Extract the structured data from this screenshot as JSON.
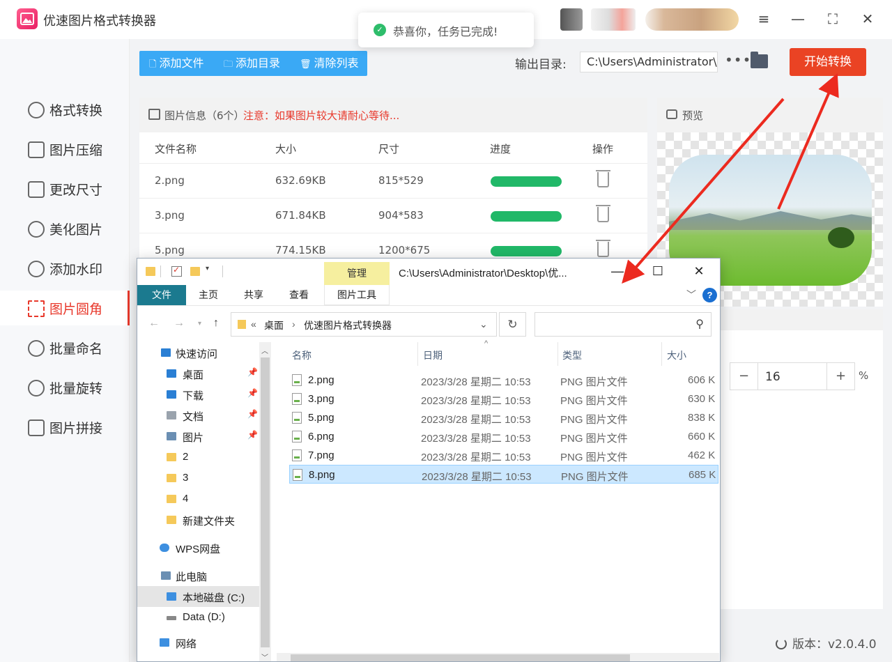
{
  "app": {
    "title": "优速图片格式转换器",
    "toast": "恭喜你，任务已完成!",
    "window_controls": [
      "≡",
      "—",
      "⛶",
      "✕"
    ]
  },
  "sidebar": {
    "items": [
      {
        "label": "格式转换",
        "icon": "convert-icon",
        "active": false
      },
      {
        "label": "图片压缩",
        "icon": "compress-icon",
        "active": false
      },
      {
        "label": "更改尺寸",
        "icon": "resize-icon",
        "active": false
      },
      {
        "label": "美化图片",
        "icon": "beautify-icon",
        "active": false
      },
      {
        "label": "添加水印",
        "icon": "watermark-icon",
        "active": false
      },
      {
        "label": "图片圆角",
        "icon": "rounded-corner-icon",
        "active": true
      },
      {
        "label": "批量命名",
        "icon": "rename-icon",
        "active": false
      },
      {
        "label": "批量旋转",
        "icon": "rotate-icon",
        "active": false
      },
      {
        "label": "图片拼接",
        "icon": "stitch-icon",
        "active": false
      }
    ]
  },
  "toolbar": {
    "add_file": "添加文件",
    "add_folder": "添加目录",
    "clear_list": "清除列表",
    "output_label": "输出目录:",
    "output_path": "C:\\Users\\Administrator\\",
    "more": "•••",
    "start": "开始转换"
  },
  "list": {
    "header_title": "图片信息（6个）",
    "header_notice": "注意：如果图片较大请耐心等待...",
    "columns": [
      "文件名称",
      "大小",
      "尺寸",
      "进度",
      "操作"
    ],
    "rows": [
      {
        "name": "2.png",
        "size": "632.69KB",
        "dims": "815*529",
        "progress": 1.0
      },
      {
        "name": "3.png",
        "size": "671.84KB",
        "dims": "904*583",
        "progress": 1.0
      },
      {
        "name": "5.png",
        "size": "774.15KB",
        "dims": "1200*675",
        "progress": 1.0
      }
    ]
  },
  "preview": {
    "label": "预览",
    "radius_value": "16",
    "radius_minus": "−",
    "radius_plus": "+",
    "radius_unit": "%"
  },
  "version": "版本：v2.0.4.0",
  "explorer": {
    "title_path": "C:\\Users\\Administrator\\Desktop\\优...",
    "manage_tab": "管理",
    "ribbon_tabs": [
      "文件",
      "主页",
      "共享",
      "查看",
      "图片工具"
    ],
    "breadcrumb": [
      "«",
      "桌面",
      "›",
      "优速图片格式转换器"
    ],
    "nav": [
      {
        "label": "快速访问",
        "color": "#2a7fd4",
        "pinned": false
      },
      {
        "label": "桌面",
        "color": "#2a7fd4",
        "pinned": true
      },
      {
        "label": "下载",
        "color": "#2a7fd4",
        "pinned": true
      },
      {
        "label": "文档",
        "color": "#9aa3ad",
        "pinned": true
      },
      {
        "label": "图片",
        "color": "#6b8fb3",
        "pinned": true
      },
      {
        "label": "2",
        "color": "#f5c95a",
        "pinned": false
      },
      {
        "label": "3",
        "color": "#f5c95a",
        "pinned": false
      },
      {
        "label": "4",
        "color": "#f5c95a",
        "pinned": false
      },
      {
        "label": "新建文件夹",
        "color": "#f5c95a",
        "pinned": false
      },
      {
        "label": "WPS网盘",
        "color": "#3d8fe0",
        "pinned": false
      },
      {
        "label": "此电脑",
        "color": "#6b8fb3",
        "pinned": false
      },
      {
        "label": "本地磁盘 (C:)",
        "color": "#3d8fe0",
        "pinned": false
      },
      {
        "label": "Data (D:)",
        "color": "#888888",
        "pinned": false
      },
      {
        "label": "网络",
        "color": "#3d8fe0",
        "pinned": false
      }
    ],
    "columns": [
      "名称",
      "日期",
      "类型",
      "大小"
    ],
    "files": [
      {
        "name": "2.png",
        "date": "2023/3/28 星期二 10:53",
        "type": "PNG 图片文件",
        "size": "606 K"
      },
      {
        "name": "3.png",
        "date": "2023/3/28 星期二 10:53",
        "type": "PNG 图片文件",
        "size": "630 K"
      },
      {
        "name": "5.png",
        "date": "2023/3/28 星期二 10:53",
        "type": "PNG 图片文件",
        "size": "838 K"
      },
      {
        "name": "6.png",
        "date": "2023/3/28 星期二 10:53",
        "type": "PNG 图片文件",
        "size": "660 K"
      },
      {
        "name": "7.png",
        "date": "2023/3/28 星期二 10:53",
        "type": "PNG 图片文件",
        "size": "462 K"
      },
      {
        "name": "8.png",
        "date": "2023/3/28 星期二 10:53",
        "type": "PNG 图片文件",
        "size": "685 K"
      }
    ],
    "selected_file": "8.png"
  },
  "colors": {
    "accent_red": "#e8382b",
    "start_button": "#ea4324",
    "toolbar_blue": "#3aa9f5",
    "progress_green": "#21b868",
    "annotation_arrow": "#ec2a1f"
  }
}
